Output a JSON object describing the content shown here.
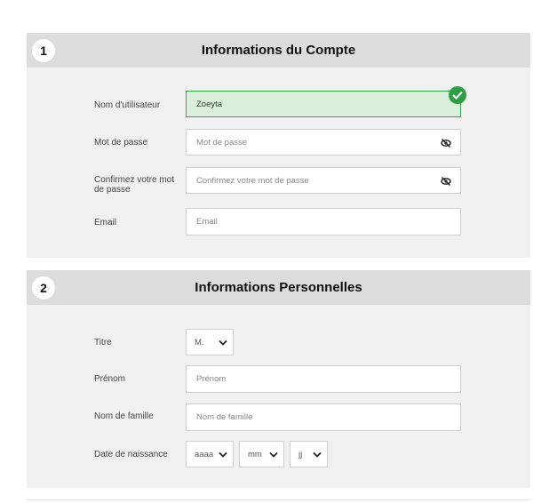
{
  "section1": {
    "number": "1",
    "title": "Informations du Compte",
    "username": {
      "label": "Nom d'utilisateur",
      "value": "Zoeyta"
    },
    "password": {
      "label": "Mot de passe",
      "placeholder": "Mot de passe"
    },
    "confirm": {
      "label": "Confirmez votre mot de passe",
      "placeholder": "Confirmez votre mot de passe"
    },
    "email": {
      "label": "Email",
      "placeholder": "Email"
    }
  },
  "section2": {
    "number": "2",
    "title": "Informations Personnelles",
    "title_field": {
      "label": "Titre",
      "value": "M."
    },
    "firstname": {
      "label": "Prénom",
      "placeholder": "Prénom"
    },
    "lastname": {
      "label": "Nom de famille",
      "placeholder": "Nom de famille"
    },
    "birthdate": {
      "label": "Date de naissance",
      "year": "aaaa",
      "month": "mm",
      "day": "jj"
    }
  },
  "colors": {
    "valid_green": "#2e9e44",
    "valid_bg": "#d9efdb",
    "header_gray": "#dcdcdc",
    "panel_gray": "#f0f0f0"
  },
  "icons": [
    "check-icon",
    "eye-slash-icon",
    "chevron-down-icon"
  ]
}
